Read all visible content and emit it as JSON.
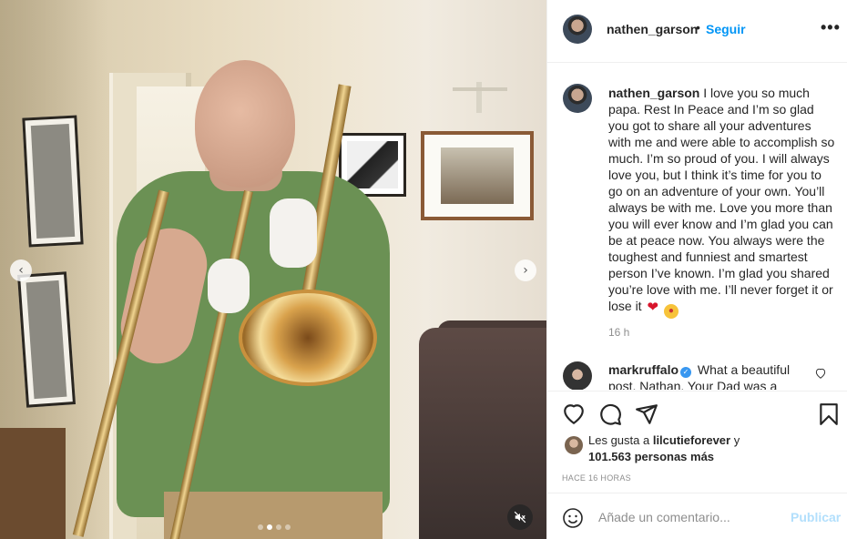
{
  "post": {
    "author": "nathen_garson",
    "follow_label": "Seguir",
    "separator": "•",
    "more_label": "•••"
  },
  "caption": {
    "username": "nathen_garson",
    "text": " I love you so much papa. Rest In Peace and I’m so glad you got to share all your adventures with me and were able to accomplish so much. I’m so proud of you. I will always love you, but I think it’s time for you to go on an adventure of your own. You’ll always be with me. Love you more than you will ever know and I’m glad you can be at peace now. You always were the toughest and funniest and smartest person I’ve known. I’m glad you shared you’re love with me. I’ll never forget it or lose it ",
    "emoji_heart": "❤",
    "emoji_kiss": "😘",
    "time": "16 h"
  },
  "comment": {
    "username": "markruffalo",
    "verified_glyph": "✓",
    "text": " What a beautiful post, Nathan. Your Dad was a"
  },
  "likes": {
    "prefix": "Les gusta a ",
    "first_user": "lilcutieforever",
    "suffix": " y",
    "others": "101.563 personas más"
  },
  "time_ago": "HACE 16 HORAS",
  "add_comment": {
    "placeholder": "Añade un comentario...",
    "publish_label": "Publicar"
  },
  "media": {
    "prev_glyph": "‹",
    "next_glyph": "›",
    "carousel_count": 4,
    "carousel_active_index": 1
  },
  "icons": {
    "like": "heart-outline-icon",
    "comment": "comment-bubble-icon",
    "share": "paper-plane-icon",
    "save": "bookmark-icon",
    "emoji": "smiley-icon",
    "mute": "speaker-muted-icon"
  },
  "colors": {
    "link_blue": "#0095f6",
    "publish_disabled": "#b2dffc",
    "secondary_text": "#8e8e8e",
    "verified": "#3897f0"
  }
}
